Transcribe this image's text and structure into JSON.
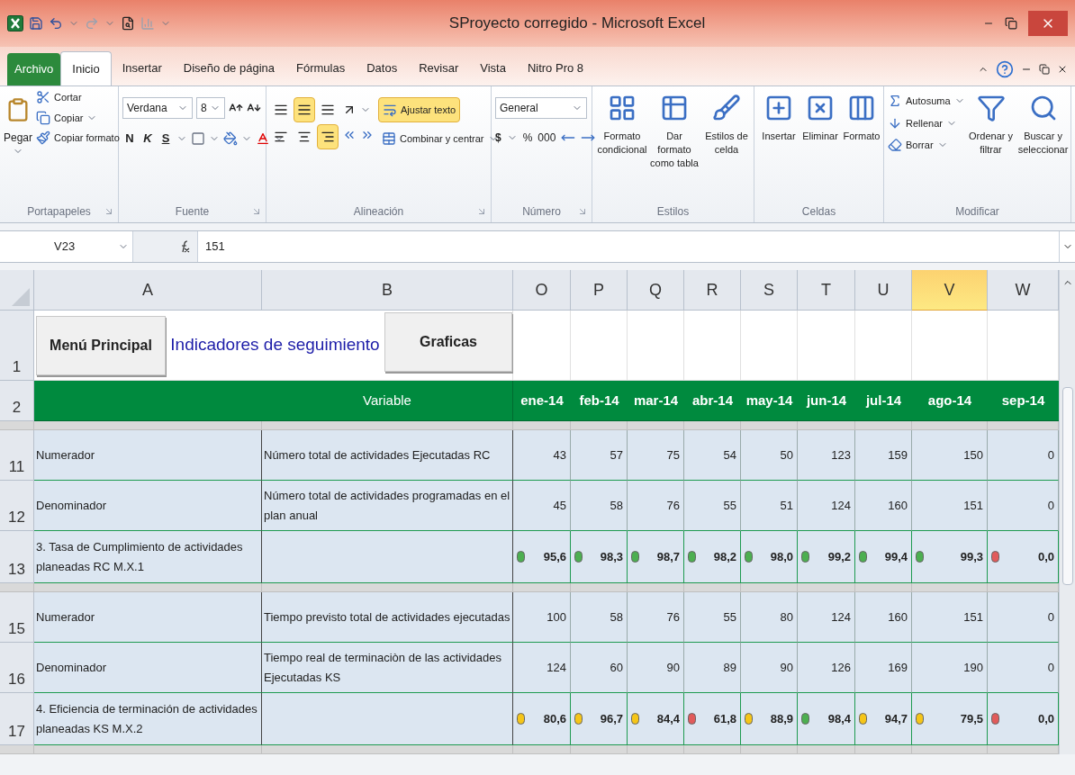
{
  "window": {
    "title": "SProyecto corregido - Microsoft Excel"
  },
  "ribbon_tabs": [
    {
      "label": "Archivo",
      "kind": "file",
      "selected": false
    },
    {
      "label": "Inicio",
      "kind": "tab",
      "selected": true
    },
    {
      "label": "Insertar",
      "kind": "tab",
      "selected": false
    },
    {
      "label": "Diseño de página",
      "kind": "tab",
      "selected": false
    },
    {
      "label": "Fórmulas",
      "kind": "tab",
      "selected": false
    },
    {
      "label": "Datos",
      "kind": "tab",
      "selected": false
    },
    {
      "label": "Revisar",
      "kind": "tab",
      "selected": false
    },
    {
      "label": "Vista",
      "kind": "tab",
      "selected": false
    },
    {
      "label": "Nitro Pro 8",
      "kind": "tab",
      "selected": false
    }
  ],
  "ribbon": {
    "clipboard": {
      "label": "Portapapeles",
      "paste": "Pegar",
      "items": [
        "Cortar",
        "Copiar",
        "Copiar formato"
      ]
    },
    "font": {
      "label": "Fuente",
      "font_name": "Verdana",
      "font_size": "8",
      "styles": [
        "N",
        "K",
        "S"
      ]
    },
    "alignment": {
      "label": "Alineación",
      "align_buttons": [
        {
          "selected": false
        },
        {
          "selected": true
        },
        {
          "selected": false
        },
        {
          "selected": false
        },
        {
          "selected": false
        },
        {
          "selected": true
        }
      ],
      "wrap_text": {
        "label": "Ajustar texto",
        "selected": true
      },
      "merge": "Combinar y centrar"
    },
    "number": {
      "label": "Número",
      "format": "General",
      "symbols": [
        "$",
        "%",
        "000"
      ]
    },
    "styles": {
      "label": "Estilos",
      "items": [
        "Formato condicional",
        "Dar formato como tabla",
        "Estilos de celda"
      ]
    },
    "cells": {
      "label": "Celdas",
      "items": [
        "Insertar",
        "Eliminar",
        "Formato"
      ]
    },
    "editing": {
      "label": "Modificar",
      "small_items": [
        "Autosuma",
        "Rellenar",
        "Borrar"
      ],
      "large_items": [
        "Ordenar y filtrar",
        "Buscar y seleccionar"
      ]
    }
  },
  "formula_bar": {
    "name_box": "V23",
    "formula": "151"
  },
  "sheet": {
    "columns": [
      {
        "label": "A",
        "selected": false
      },
      {
        "label": "B",
        "selected": false
      },
      {
        "label": "O",
        "selected": false
      },
      {
        "label": "P",
        "selected": false
      },
      {
        "label": "Q",
        "selected": false
      },
      {
        "label": "R",
        "selected": false
      },
      {
        "label": "S",
        "selected": false
      },
      {
        "label": "T",
        "selected": false
      },
      {
        "label": "U",
        "selected": false
      },
      {
        "label": "V",
        "selected": true
      },
      {
        "label": "W",
        "selected": false
      }
    ],
    "top_row": {
      "number": "1",
      "menu_button": "Menú Principal",
      "title": "Indicadores de seguimiento",
      "charts_button": "Graficas"
    },
    "header_row": {
      "number": "2",
      "variable": "Variable",
      "months": [
        "ene-14",
        "feb-14",
        "mar-14",
        "abr-14",
        "may-14",
        "jun-14",
        "jul-14",
        "ago-14",
        "sep-14"
      ]
    },
    "rows": [
      {
        "kind": "gap"
      },
      {
        "kind": "data",
        "number": "11",
        "label": "Numerador",
        "variable": "Número total de actividades Ejecutadas RC",
        "values": [
          "43",
          "57",
          "75",
          "54",
          "50",
          "123",
          "159",
          "150",
          "0"
        ]
      },
      {
        "kind": "data",
        "number": "12",
        "label": "Denominador",
        "variable": "Número total de actividades programadas en el plan anual",
        "values": [
          "45",
          "58",
          "76",
          "55",
          "51",
          "124",
          "160",
          "151",
          "0"
        ]
      },
      {
        "kind": "indicator",
        "number": "13",
        "label": "3. Tasa de Cumplimiento de actividades planeadas RC M.X.1",
        "cells": [
          {
            "value": "95,6",
            "color": "#4caf50"
          },
          {
            "value": "98,3",
            "color": "#4caf50"
          },
          {
            "value": "98,7",
            "color": "#4caf50"
          },
          {
            "value": "98,2",
            "color": "#4caf50"
          },
          {
            "value": "98,0",
            "color": "#4caf50"
          },
          {
            "value": "99,2",
            "color": "#4caf50"
          },
          {
            "value": "99,4",
            "color": "#4caf50"
          },
          {
            "value": "99,3",
            "color": "#4caf50"
          },
          {
            "value": "0,0",
            "color": "#e15b5b"
          }
        ]
      },
      {
        "kind": "gap"
      },
      {
        "kind": "data",
        "number": "15",
        "label": "Numerador",
        "variable": "Tiempo previsto total de actividades ejecutadas",
        "values": [
          "100",
          "58",
          "76",
          "55",
          "80",
          "124",
          "160",
          "151",
          "0"
        ]
      },
      {
        "kind": "data",
        "number": "16",
        "label": "Denominador",
        "variable": "Tiempo real de terminaciòn de las actividades Ejecutadas KS",
        "values": [
          "124",
          "60",
          "90",
          "89",
          "90",
          "126",
          "169",
          "190",
          "0"
        ]
      },
      {
        "kind": "indicator",
        "number": "17",
        "label": "4. Eficiencia de terminación de actividades planeadas KS M.X.2",
        "cells": [
          {
            "value": "80,6",
            "color": "#f5c518"
          },
          {
            "value": "96,7",
            "color": "#f5c518"
          },
          {
            "value": "84,4",
            "color": "#f5c518"
          },
          {
            "value": "61,8",
            "color": "#e15b5b"
          },
          {
            "value": "88,9",
            "color": "#f5c518"
          },
          {
            "value": "98,4",
            "color": "#4caf50"
          },
          {
            "value": "94,7",
            "color": "#f5c518"
          },
          {
            "value": "79,5",
            "color": "#f5c518"
          },
          {
            "value": "0,0",
            "color": "#e15b5b"
          }
        ]
      },
      {
        "kind": "gap"
      }
    ]
  }
}
